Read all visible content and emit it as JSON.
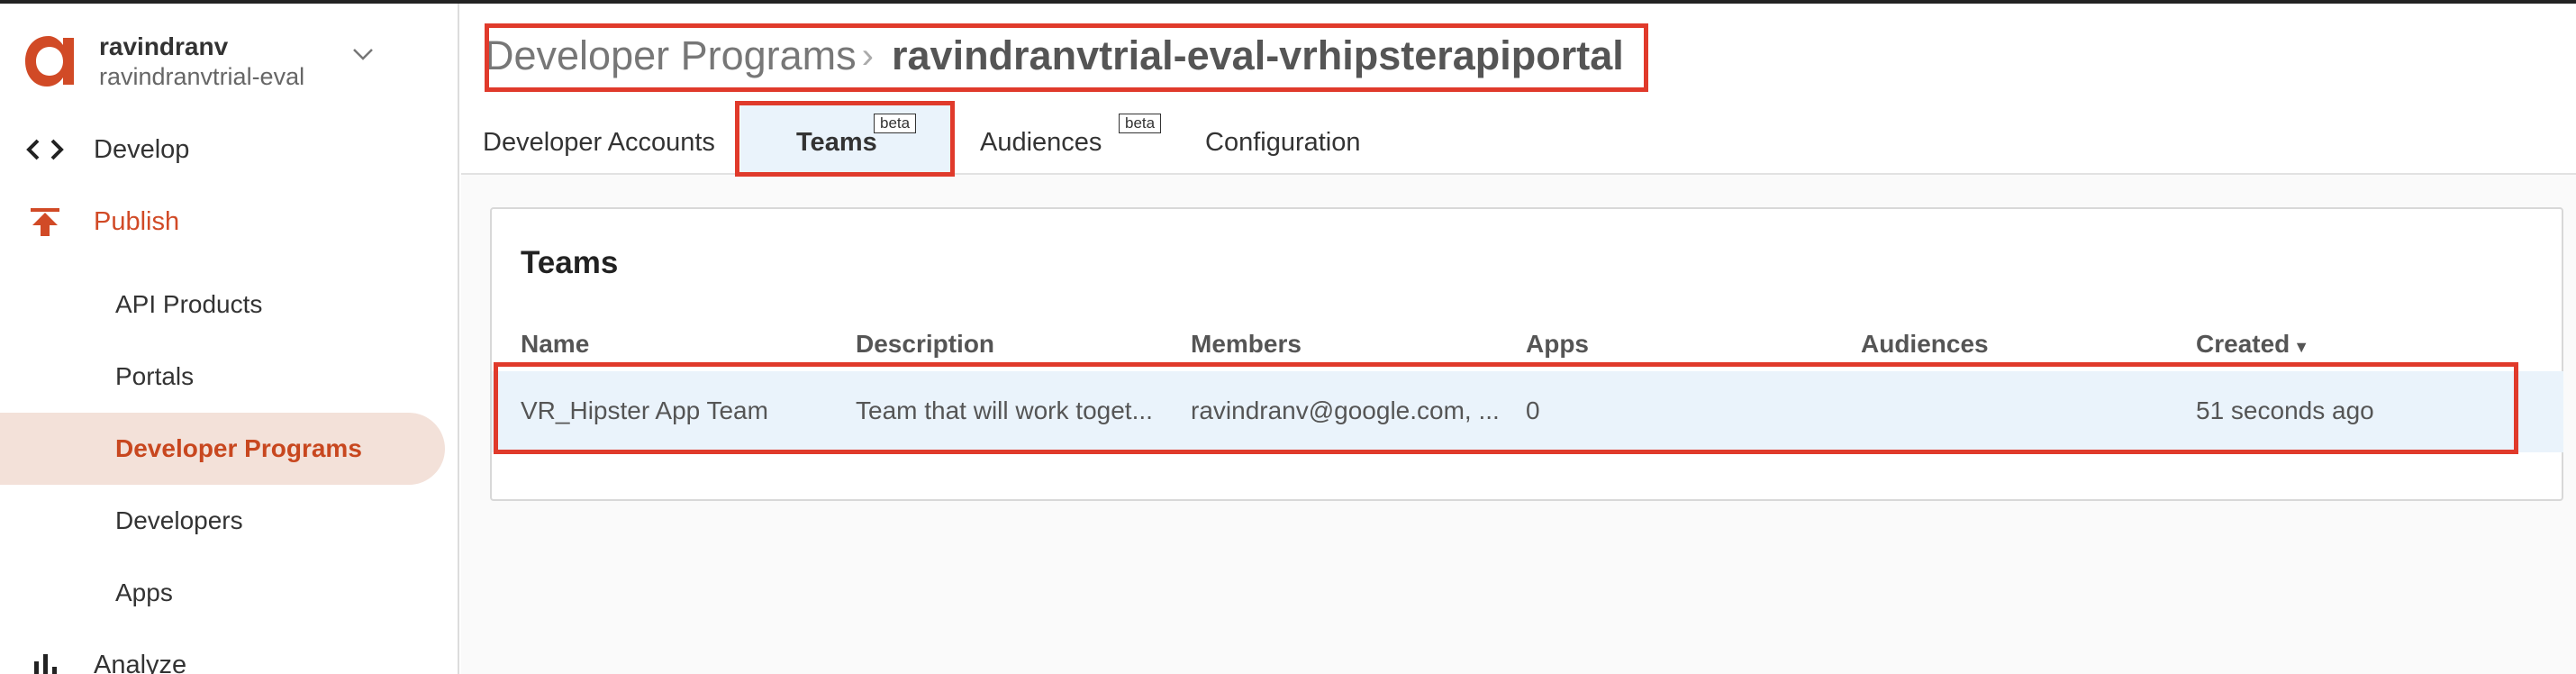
{
  "org": {
    "user": "ravindranv",
    "name": "ravindranvtrial-eval"
  },
  "nav": {
    "develop": "Develop",
    "publish": "Publish",
    "analyze": "Analyze",
    "sub_items": [
      "API Products",
      "Portals",
      "Developer Programs",
      "Developers",
      "Apps"
    ]
  },
  "breadcrumb": {
    "parent": "Developer Programs",
    "current": "ravindranvtrial-eval-vrhipsterapiportal"
  },
  "tabs": {
    "developer_accounts": "Developer Accounts",
    "teams": "Teams",
    "audiences": "Audiences",
    "configuration": "Configuration",
    "beta_label": "beta"
  },
  "card": {
    "title": "Teams",
    "columns": [
      "Name",
      "Description",
      "Members",
      "Apps",
      "Audiences",
      "Created"
    ],
    "sort_indicator": "▼",
    "rows": [
      {
        "name": "VR_Hipster App Team",
        "description": "Team that will work toget...",
        "members": "ravindranv@google.com, ...",
        "apps": "0",
        "audiences": "",
        "created": "51 seconds ago"
      }
    ]
  },
  "colors": {
    "accent": "#d14a26",
    "selected_bg": "#f3e1d9",
    "highlight_border": "#e03a2b",
    "row_bg": "#eaf3fb"
  },
  "icons": {
    "logo": "apigee-logo-icon",
    "develop": "code-brackets-icon",
    "publish": "publish-upload-icon",
    "analyze": "bar-chart-icon",
    "org_switch": "chevron-down-icon"
  }
}
